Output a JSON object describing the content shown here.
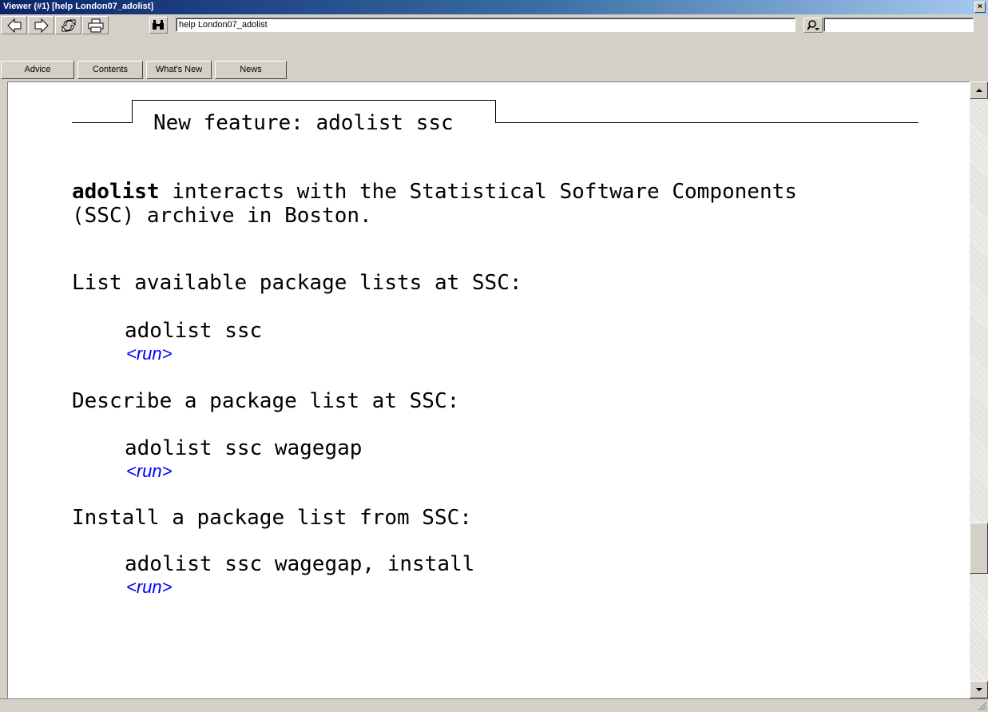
{
  "window": {
    "title": "Viewer (#1) [help London07_adolist]",
    "close_glyph": "×"
  },
  "toolbar": {
    "buttons": [
      {
        "name": "back-button",
        "icon": "arrow-left-icon"
      },
      {
        "name": "forward-button",
        "icon": "arrow-right-icon"
      },
      {
        "name": "refresh-button",
        "icon": "refresh-icon"
      },
      {
        "name": "print-button",
        "icon": "printer-icon"
      }
    ],
    "find_icon": "binoculars-icon",
    "command_value": "help London07_adolist",
    "search_icon": "search-dropdown-icon",
    "search_value": ""
  },
  "tabs": [
    "Advice",
    "Contents",
    "What's New",
    "News"
  ],
  "content": {
    "header_title": "New feature: adolist ssc",
    "intro_cmd": "adolist",
    "intro_rest_line1": " interacts with the Statistical Software Components",
    "intro_line2": "(SSC) archive in Boston.",
    "sections": [
      {
        "heading": "List available package lists at SSC:",
        "command": "adolist ssc",
        "link": "<run>"
      },
      {
        "heading": "Describe a package list at SSC:",
        "command": "adolist ssc wagegap",
        "link": "<run>"
      },
      {
        "heading": "Install a package list from SSC:",
        "command": "adolist ssc wagegap, install",
        "link": "<run>"
      }
    ]
  },
  "status": {
    "text": ""
  },
  "colors": {
    "link": "#0000ff",
    "titlebar_start": "#0a246a",
    "titlebar_end": "#a6caf0",
    "chrome": "#d4d0c8"
  }
}
